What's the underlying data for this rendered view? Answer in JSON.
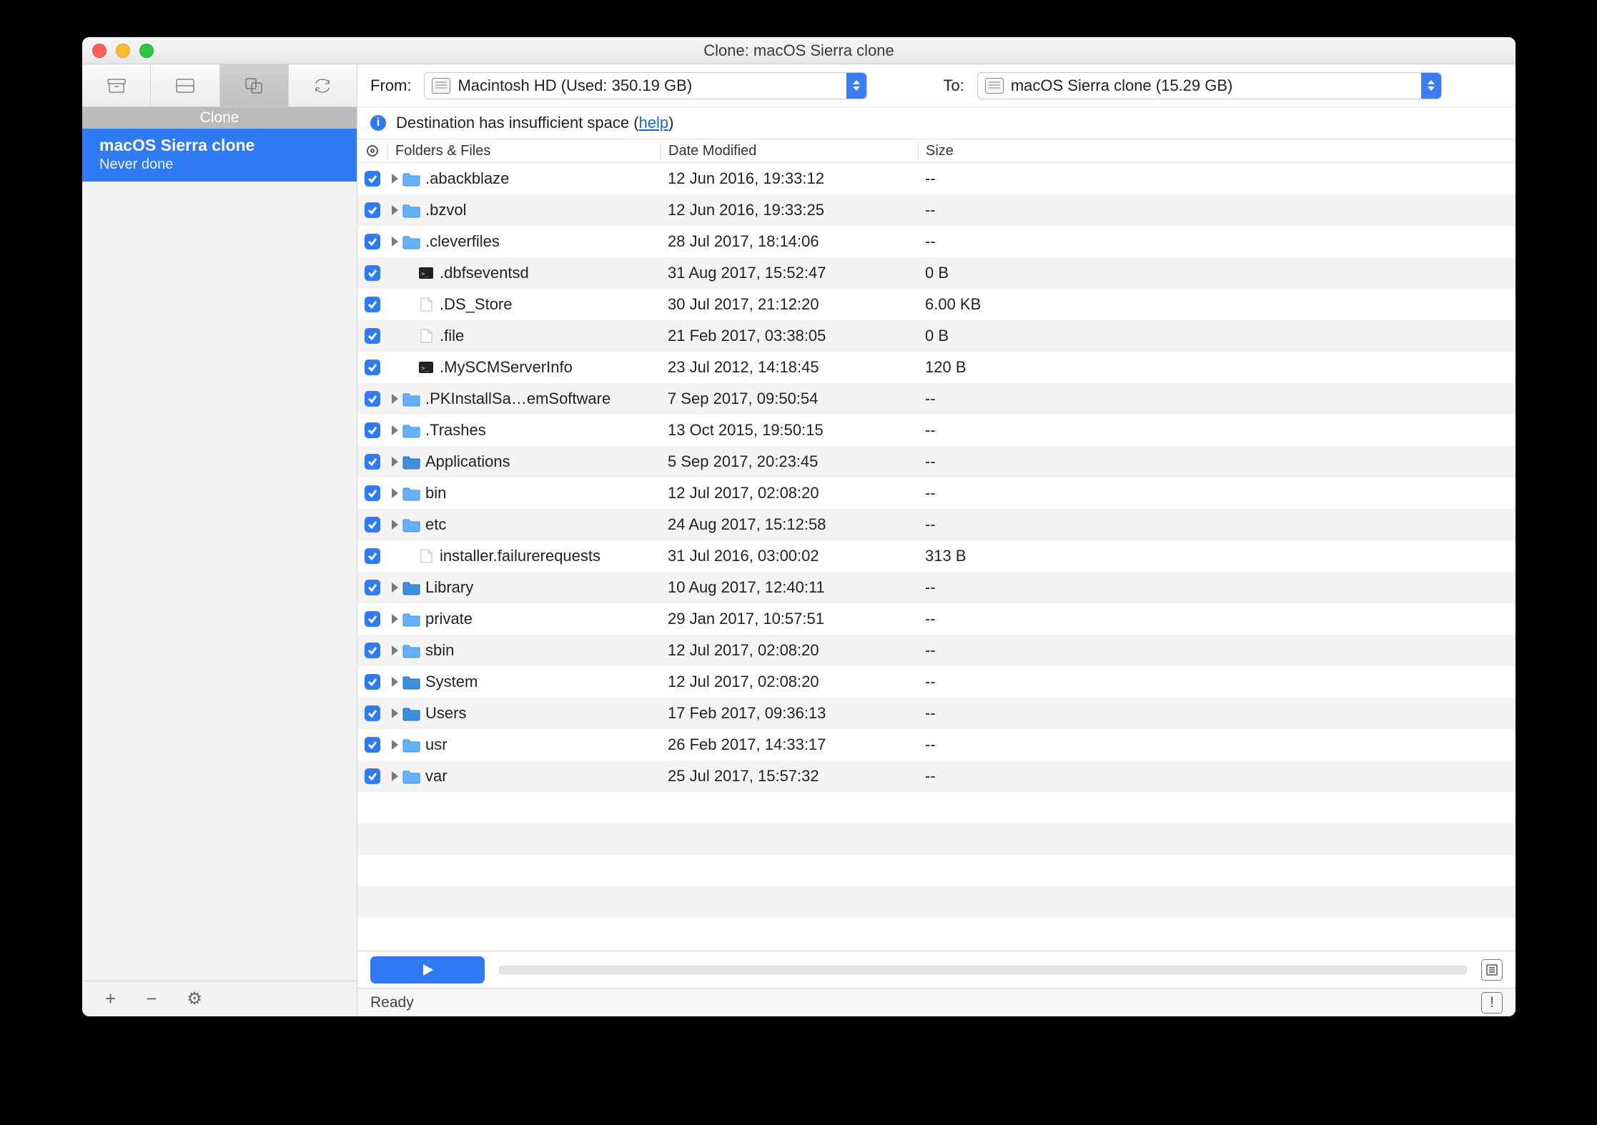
{
  "window": {
    "title": "Clone: macOS Sierra clone"
  },
  "sidebar": {
    "section_label": "Clone",
    "item": {
      "name": "macOS Sierra clone",
      "subtitle": "Never done"
    },
    "footer": {
      "add": "+",
      "remove": "−",
      "gear": "⚙"
    }
  },
  "srcdest": {
    "from_label": "From:",
    "from_value": "Macintosh HD (Used: 350.19 GB)",
    "to_label": "To:",
    "to_value": "macOS Sierra clone (15.29 GB)"
  },
  "warning": {
    "text_prefix": "Destination has insufficient space (",
    "link": "help",
    "text_suffix": ")"
  },
  "columns": {
    "name": "Folders & Files",
    "date": "Date Modified",
    "size": "Size"
  },
  "rows": [
    {
      "name": ".abackblaze",
      "date": "12 Jun 2016, 19:33:12",
      "size": "--",
      "kind": "folder",
      "expandable": true
    },
    {
      "name": ".bzvol",
      "date": "12 Jun 2016, 19:33:25",
      "size": "--",
      "kind": "folder",
      "expandable": true
    },
    {
      "name": ".cleverfiles",
      "date": "28 Jul 2017, 18:14:06",
      "size": "--",
      "kind": "folder",
      "expandable": true
    },
    {
      "name": ".dbfseventsd",
      "date": "31 Aug 2017, 15:52:47",
      "size": "0 B",
      "kind": "exec",
      "expandable": false
    },
    {
      "name": ".DS_Store",
      "date": "30 Jul 2017, 21:12:20",
      "size": "6.00 KB",
      "kind": "file",
      "expandable": false
    },
    {
      "name": ".file",
      "date": "21 Feb 2017, 03:38:05",
      "size": "0 B",
      "kind": "file",
      "expandable": false
    },
    {
      "name": ".MySCMServerInfo",
      "date": "23 Jul 2012, 14:18:45",
      "size": "120 B",
      "kind": "exec",
      "expandable": false
    },
    {
      "name": ".PKInstallSa…emSoftware",
      "date": "7 Sep 2017, 09:50:54",
      "size": "--",
      "kind": "folder",
      "expandable": true
    },
    {
      "name": ".Trashes",
      "date": "13 Oct 2015, 19:50:15",
      "size": "--",
      "kind": "folder",
      "expandable": true
    },
    {
      "name": "Applications",
      "date": "5 Sep 2017, 20:23:45",
      "size": "--",
      "kind": "bluefolder",
      "expandable": true
    },
    {
      "name": "bin",
      "date": "12 Jul 2017, 02:08:20",
      "size": "--",
      "kind": "folder",
      "expandable": true
    },
    {
      "name": "etc",
      "date": "24 Aug 2017, 15:12:58",
      "size": "--",
      "kind": "folder",
      "expandable": true
    },
    {
      "name": "installer.failurerequests",
      "date": "31 Jul 2016, 03:00:02",
      "size": "313 B",
      "kind": "file",
      "expandable": false
    },
    {
      "name": "Library",
      "date": "10 Aug 2017, 12:40:11",
      "size": "--",
      "kind": "bluefolder",
      "expandable": true
    },
    {
      "name": "private",
      "date": "29 Jan 2017, 10:57:51",
      "size": "--",
      "kind": "folder",
      "expandable": true
    },
    {
      "name": "sbin",
      "date": "12 Jul 2017, 02:08:20",
      "size": "--",
      "kind": "folder",
      "expandable": true
    },
    {
      "name": "System",
      "date": "12 Jul 2017, 02:08:20",
      "size": "--",
      "kind": "bluefolder",
      "expandable": true
    },
    {
      "name": "Users",
      "date": "17 Feb 2017, 09:36:13",
      "size": "--",
      "kind": "bluefolder",
      "expandable": true
    },
    {
      "name": "usr",
      "date": "26 Feb 2017, 14:33:17",
      "size": "--",
      "kind": "folder",
      "expandable": true
    },
    {
      "name": "var",
      "date": "25 Jul 2017, 15:57:32",
      "size": "--",
      "kind": "folder",
      "expandable": true
    }
  ],
  "status": {
    "text": "Ready"
  }
}
